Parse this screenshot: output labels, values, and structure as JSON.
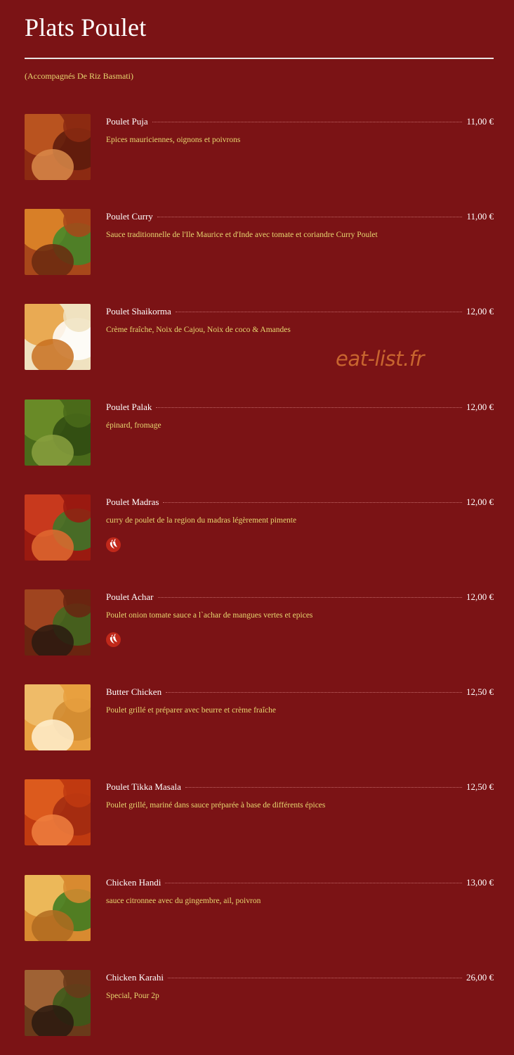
{
  "header": {
    "title": "Plats Poulet",
    "subtitle": "(Accompagnés De Riz Basmati)"
  },
  "watermark": "eat-list.fr",
  "colors": {
    "background": "#7b1315",
    "name_text": "#ffffff",
    "description_text": "#e7d770",
    "spicy_badge": "#c0281a",
    "watermark": "#c8652f"
  },
  "items": [
    {
      "name": "Poulet Puja",
      "price": "11,00 €",
      "description": "Epices mauriciennes, oignons et poivrons",
      "spicy": false,
      "image_icon": "curry-dish-photo"
    },
    {
      "name": "Poulet Curry",
      "price": "11,00 €",
      "description": "Sauce traditionnelle de l'Ile Maurice et d'Inde avec tomate et coriandre Curry Poulet",
      "spicy": false,
      "image_icon": "curry-dish-photo"
    },
    {
      "name": "Poulet Shaikorma",
      "price": "12,00 €",
      "description": "Crème fraîche, Noix de Cajou, Noix de coco & Amandes",
      "spicy": false,
      "image_icon": "korma-dish-photo"
    },
    {
      "name": "Poulet Palak",
      "price": "12,00 €",
      "description": "épinard, fromage",
      "spicy": false,
      "image_icon": "spinach-dish-photo"
    },
    {
      "name": "Poulet Madras",
      "price": "12,00 €",
      "description": "curry de poulet de la region du madras légèrement pimente",
      "spicy": true,
      "image_icon": "curry-dish-photo"
    },
    {
      "name": "Poulet Achar",
      "price": "12,00 €",
      "description": "Poulet onion tomate sauce a l`achar de mangues vertes et epices",
      "spicy": true,
      "image_icon": "curry-dish-photo"
    },
    {
      "name": "Butter Chicken",
      "price": "12,50 €",
      "description": "Poulet grillé et préparer avec beurre et crème fraîche",
      "spicy": false,
      "image_icon": "butter-chicken-photo"
    },
    {
      "name": "Poulet Tikka Masala",
      "price": "12,50 €",
      "description": "Poulet grillé, mariné dans sauce préparée à base de différents épices",
      "spicy": false,
      "image_icon": "tikka-dish-photo"
    },
    {
      "name": "Chicken Handi",
      "price": "13,00 €",
      "description": "sauce citronnee avec du gingembre, ail, poivron",
      "spicy": false,
      "image_icon": "handi-dish-photo"
    },
    {
      "name": "Chicken Karahi",
      "price": "26,00 €",
      "description": "Special, Pour 2p",
      "spicy": false,
      "image_icon": "karahi-dish-photo"
    }
  ]
}
